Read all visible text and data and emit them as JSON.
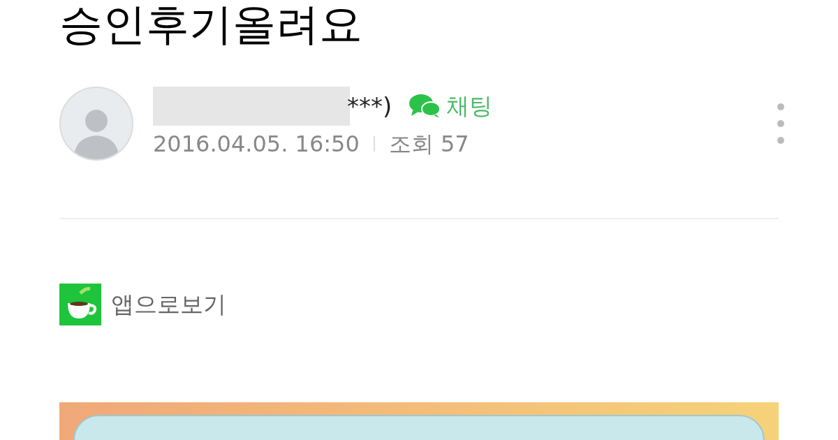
{
  "post": {
    "title": "승인후기올려요",
    "author": {
      "name_visible": "***)",
      "chat_label": "채팅",
      "date": "2016.04.05. 16:50",
      "views": "조회 57"
    },
    "app_link": "앱으로보기"
  }
}
